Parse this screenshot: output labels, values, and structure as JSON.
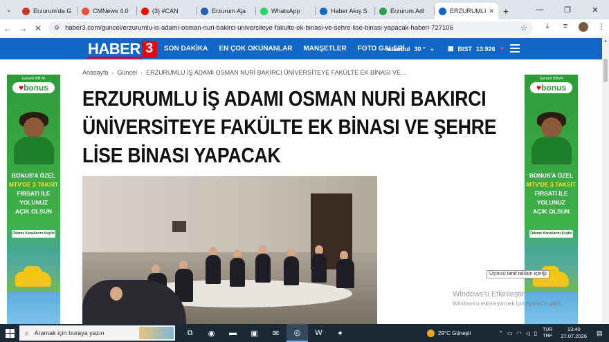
{
  "browser": {
    "tabs": [
      {
        "label": "Erzurum'da G",
        "color": "#c0392b"
      },
      {
        "label": "CMNews 4.0",
        "color": "#e74c3c"
      },
      {
        "label": "(3) #CAN",
        "color": "#ff0000"
      },
      {
        "label": "Erzurum Aja",
        "color": "#2c5fb3"
      },
      {
        "label": "WhatsApp",
        "color": "#25d366"
      },
      {
        "label": "Haber Akış S",
        "color": "#1167c6"
      },
      {
        "label": "Erzurum Adl",
        "color": "#2e9c4a"
      },
      {
        "label": "ERZURUMLU",
        "color": "#1167c6",
        "active": true
      }
    ],
    "tab_close": "✕",
    "new_tab": "+",
    "url": "haber3.com/guncel/erzurumlu-is-adami-osman-nuri-bakirci-universiteye-fakulte-ek-binasi-ve-sehre-lise-binasi-yapacak-haberi-727106"
  },
  "site": {
    "logo_text": "HABER",
    "logo_num": "3",
    "nav": [
      "SON DAKİKA",
      "EN ÇOK OKUNANLAR",
      "MANŞETLER",
      "FOTO GALERİ"
    ],
    "weather_city": "İstanbul",
    "weather_temp": "30 °",
    "bist_label": "BIST",
    "bist_value": "13.926"
  },
  "breadcrumb": [
    "Anasayfa",
    "Güncel",
    "ERZURUMLU İŞ ADAMI OSMAN NURİ BAKIRCI ÜNİVERSİTEYE FAKÜLTE EK BİNASI VE..."
  ],
  "article": {
    "title_lines": [
      "ERZURUMLU İŞ ADAMI OSMAN NURİ BAKIRCI",
      "ÜNİVERSİTEYE FAKÜLTE EK BİNASI VE ŞEHRE",
      "LİSE BİNASI YAPACAK"
    ]
  },
  "ad": {
    "bank": "Garanti BBVA",
    "bonus_heart": "♥",
    "bonus": "bonus",
    "promo": [
      "BONUS'A ÖZEL",
      "MTV'DE 3 TAKSİT",
      "FIRSATI İLE",
      "YOLUNUZ",
      "AÇIK OLSUN"
    ],
    "cta": "Ödeme Kanallarını Keşfet",
    "third_party_label": "Üçüncü taraf reklam içeriği"
  },
  "watermark": {
    "line1": "Windows'u Etkinleştir",
    "line2": "Windows'u etkinleştirmek için Ayarlar'a gidin."
  },
  "taskbar": {
    "search_placeholder": "Aramak için buraya yazın",
    "weather": "29°C  Güneşli",
    "lang1": "TUR",
    "lang2": "TRF",
    "time": "13:40",
    "date": "27.07.2026"
  }
}
